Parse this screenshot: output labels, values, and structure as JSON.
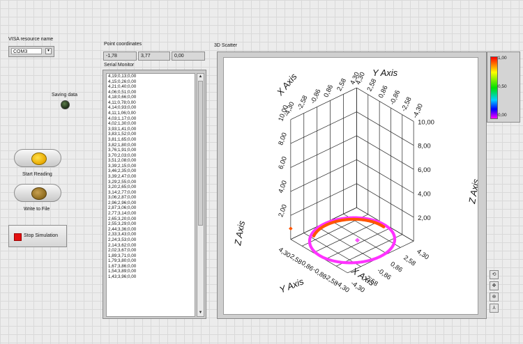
{
  "visa": {
    "label": "VISA resource name",
    "value": "COM3"
  },
  "saving": {
    "label": "Saving data"
  },
  "buttons": {
    "start_reading": "Start Reading",
    "write_to_file": "Write to File",
    "stop_simulation": "Stop Simulation"
  },
  "point_coordinates": {
    "label": "Point coordinates",
    "x": "-1,78",
    "y": "3,77",
    "z": "0,00"
  },
  "serial_monitor": {
    "label": "Serial Monitor",
    "lines": [
      "4,19;0,13;0,00",
      "4,15;0,26;0,00",
      "4,21;0,40;0,00",
      "4,06;0,51;0,00",
      "4,18;0,66;0,00",
      "4,11;0,78;0,00",
      "4,14;0,93;0,00",
      "4,11;1,06;0,00",
      "4,03;1,17;0,00",
      "4,02;1,30;0,00",
      "3,93;1,41;0,00",
      "3,83;1,52;0,00",
      "3,81;1,65;0,00",
      "3,82;1,80;0,00",
      "3,76;1,91;0,00",
      "3,70;2,03;0,00",
      "3,51;2,08;0,00",
      "3,39;2,15;0,00",
      "3,46;2,35;0,00",
      "3,39;2,47;0,00",
      "3,29;2,55;0,00",
      "3,20;2,65;0,00",
      "3,14;2,77;0,00",
      "3,06;2,87;0,00",
      "2,96;2,96;0,00",
      "2,87;3,06;0,00",
      "2,77;3,14;0,00",
      "2,65;3,20;0,00",
      "2,55;3,29;0,00",
      "2,44;3,36;0,00",
      "2,33;3,43;0,00",
      "2,24;3,53;0,00",
      "2,14;3,62;0,00",
      "2,02;3,67;0,00",
      "1,89;3,71;0,00",
      "1,79;3,80;0,00",
      "1,67;3,86;0,00",
      "1,54;3,89;0,00",
      "1,43;3,96;0,00"
    ]
  },
  "scatter": {
    "label": "3D Scatter",
    "x_axis_title": "X Axis",
    "y_axis_title": "Y Axis",
    "z_axis_title": "Z Axis",
    "xy_ticks": [
      "-4,30",
      "-2,58",
      "-0,86",
      "0,86",
      "2,58",
      "4,30"
    ],
    "z_ticks": [
      "2,00",
      "4,00",
      "6,00",
      "8,00",
      "10,00"
    ],
    "colors": {
      "ring": "#ff33ff",
      "trace": "#ff5500",
      "current": "#ff55ff"
    },
    "colorbar": {
      "max": "1,00",
      "mid": "0,50",
      "min": "0,00"
    }
  },
  "chart_data": {
    "type": "scatter",
    "x_range": [
      -4.3,
      4.3
    ],
    "y_range": [
      -4.3,
      4.3
    ],
    "z_range": [
      0,
      10
    ],
    "series": [
      {
        "shape": "circle",
        "radius": 4.2,
        "z": 0
      },
      {
        "shape": "arc",
        "radius": 4.2,
        "z": 0
      },
      {
        "points": [
          [
            -1.78,
            3.77,
            0.0
          ]
        ]
      },
      {
        "points": [
          [
            4.3,
            -4.3,
            0.9
          ]
        ]
      }
    ]
  },
  "toolbar": {
    "icons": [
      "rotate-icon",
      "pan-icon",
      "zoom-icon",
      "axes-icon"
    ]
  }
}
